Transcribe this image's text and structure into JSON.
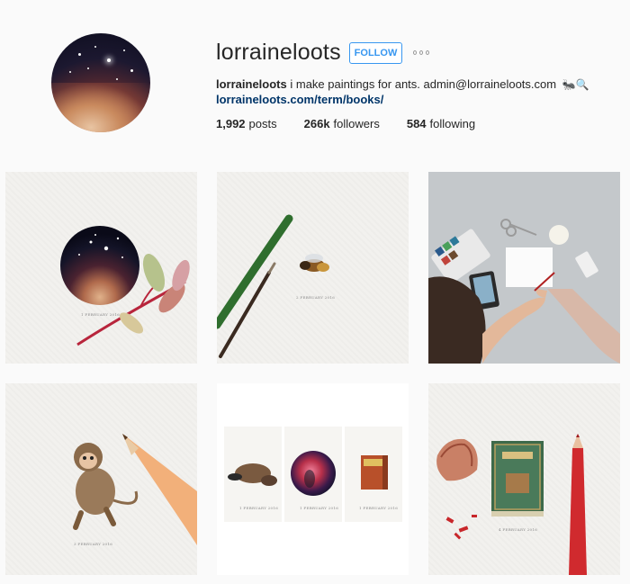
{
  "profile": {
    "username": "lorraineloots",
    "follow_label": "FOLLOW",
    "bio_name": "lorraineloots",
    "bio_text": "i make paintings for ants. admin@lorraineloots.com",
    "bio_emoji": "🐜🔍",
    "link": "lorraineloots.com/term/books/",
    "stats": {
      "posts_count": "1,992",
      "posts_label": "posts",
      "followers_count": "266k",
      "followers_label": "followers",
      "following_count": "584",
      "following_label": "following"
    }
  },
  "posts": [
    {
      "subject": "galaxy painting with leaf",
      "caption": "1 FEBRUARY 2016"
    },
    {
      "subject": "bee painting with brush",
      "caption": "2 FEBRUARY 2016"
    },
    {
      "subject": "artist painting at desk"
    },
    {
      "subject": "monkey painting with pencil",
      "caption": "3 FEBRUARY 2016"
    },
    {
      "subject": "platypus, nebula and book paintings",
      "captions": [
        "1 FEBRUARY 2016",
        "1 FEBRUARY 2016",
        "1 FEBRUARY 2016"
      ]
    },
    {
      "subject": "book painting with red pencil",
      "caption": "4 FEBRUARY 2016"
    }
  ],
  "colors": {
    "link_blue": "#003569",
    "follow_blue": "#3897f0",
    "text": "#262626",
    "background": "#fafafa"
  },
  "icons": {
    "more": "more-dots-icon"
  }
}
